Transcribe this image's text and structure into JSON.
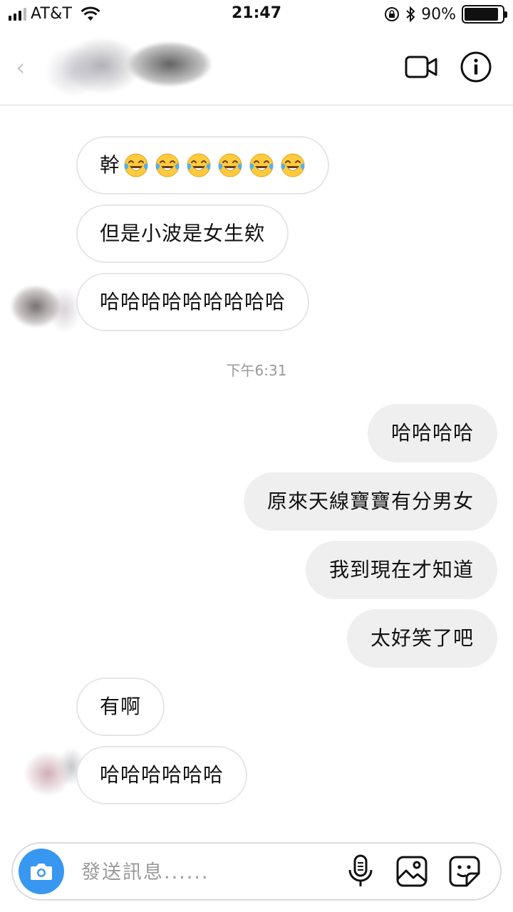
{
  "status_bar": {
    "carrier": "AT&T",
    "time": "21:47",
    "battery_percent": "90%",
    "battery_level": 0.9
  },
  "header": {
    "icons": [
      "back-chevron-icon",
      "video-call-icon",
      "info-icon"
    ]
  },
  "messages": [
    {
      "direction": "in",
      "text": "幹",
      "emoji": [
        "face-with-tears-of-joy",
        "face-with-tears-of-joy",
        "face-with-tears-of-joy",
        "face-with-tears-of-joy",
        "face-with-tears-of-joy",
        "face-with-tears-of-joy"
      ]
    },
    {
      "direction": "in",
      "text": "但是小波是女生欸"
    },
    {
      "direction": "in",
      "text": "哈哈哈哈哈哈哈哈哈"
    },
    {
      "direction": "out",
      "text": "哈哈哈哈"
    },
    {
      "direction": "out",
      "text": "原來天線寶寶有分男女"
    },
    {
      "direction": "out",
      "text": "我到現在才知道"
    },
    {
      "direction": "out",
      "text": "太好笑了吧"
    },
    {
      "direction": "in",
      "text": "有啊"
    },
    {
      "direction": "in",
      "text": "哈哈哈哈哈哈"
    }
  ],
  "timestamp": "下午6:31",
  "composer": {
    "placeholder": "發送訊息......",
    "icons": [
      "camera-icon",
      "microphone-icon",
      "gallery-icon",
      "sticker-icon"
    ],
    "accent": "#3897f0"
  },
  "colors": {
    "incoming_bubble_border": "#e6e6e6",
    "outgoing_bubble": "#efefef",
    "timestamp_text": "#999999"
  }
}
